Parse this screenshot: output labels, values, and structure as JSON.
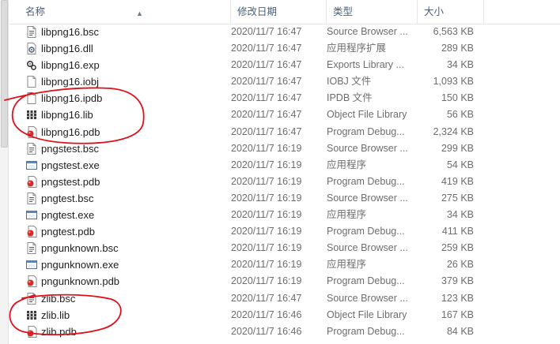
{
  "header": {
    "name": "名称",
    "date": "修改日期",
    "type": "类型",
    "size": "大小"
  },
  "files": [
    {
      "name": "libpng16.bsc",
      "date": "2020/11/7 16:47",
      "type": "Source Browser ...",
      "size": "6,563 KB",
      "icon": "file-bsc-icon"
    },
    {
      "name": "libpng16.dll",
      "date": "2020/11/7 16:47",
      "type": "应用程序扩展",
      "size": "289 KB",
      "icon": "file-dll-icon"
    },
    {
      "name": "libpng16.exp",
      "date": "2020/11/7 16:47",
      "type": "Exports Library ...",
      "size": "34 KB",
      "icon": "file-exp-icon"
    },
    {
      "name": "libpng16.iobj",
      "date": "2020/11/7 16:47",
      "type": "IOBJ 文件",
      "size": "1,093 KB",
      "icon": "file-blank-icon"
    },
    {
      "name": "libpng16.ipdb",
      "date": "2020/11/7 16:47",
      "type": "IPDB 文件",
      "size": "150 KB",
      "icon": "file-blank-icon"
    },
    {
      "name": "libpng16.lib",
      "date": "2020/11/7 16:47",
      "type": "Object File Library",
      "size": "56 KB",
      "icon": "file-lib-icon"
    },
    {
      "name": "libpng16.pdb",
      "date": "2020/11/7 16:47",
      "type": "Program Debug...",
      "size": "2,324 KB",
      "icon": "file-pdb-icon"
    },
    {
      "name": "pngstest.bsc",
      "date": "2020/11/7 16:19",
      "type": "Source Browser ...",
      "size": "299 KB",
      "icon": "file-bsc-icon"
    },
    {
      "name": "pngstest.exe",
      "date": "2020/11/7 16:19",
      "type": "应用程序",
      "size": "54 KB",
      "icon": "file-exe-icon"
    },
    {
      "name": "pngstest.pdb",
      "date": "2020/11/7 16:19",
      "type": "Program Debug...",
      "size": "419 KB",
      "icon": "file-pdb-icon"
    },
    {
      "name": "pngtest.bsc",
      "date": "2020/11/7 16:19",
      "type": "Source Browser ...",
      "size": "275 KB",
      "icon": "file-bsc-icon"
    },
    {
      "name": "pngtest.exe",
      "date": "2020/11/7 16:19",
      "type": "应用程序",
      "size": "34 KB",
      "icon": "file-exe-icon"
    },
    {
      "name": "pngtest.pdb",
      "date": "2020/11/7 16:19",
      "type": "Program Debug...",
      "size": "411 KB",
      "icon": "file-pdb-icon"
    },
    {
      "name": "pngunknown.bsc",
      "date": "2020/11/7 16:19",
      "type": "Source Browser ...",
      "size": "259 KB",
      "icon": "file-bsc-icon"
    },
    {
      "name": "pngunknown.exe",
      "date": "2020/11/7 16:19",
      "type": "应用程序",
      "size": "26 KB",
      "icon": "file-exe-icon"
    },
    {
      "name": "pngunknown.pdb",
      "date": "2020/11/7 16:19",
      "type": "Program Debug...",
      "size": "379 KB",
      "icon": "file-pdb-icon"
    },
    {
      "name": "zlib.bsc",
      "date": "2020/11/7 16:47",
      "type": "Source Browser ...",
      "size": "123 KB",
      "icon": "file-bsc-icon"
    },
    {
      "name": "zlib.lib",
      "date": "2020/11/7 16:46",
      "type": "Object File Library",
      "size": "167 KB",
      "icon": "file-lib-icon"
    },
    {
      "name": "zlib.pdb",
      "date": "2020/11/7 16:46",
      "type": "Program Debug...",
      "size": "84 KB",
      "icon": "file-pdb-icon"
    }
  ],
  "colors": {
    "header_text": "#4c607a",
    "annotation": "#e0101a"
  }
}
